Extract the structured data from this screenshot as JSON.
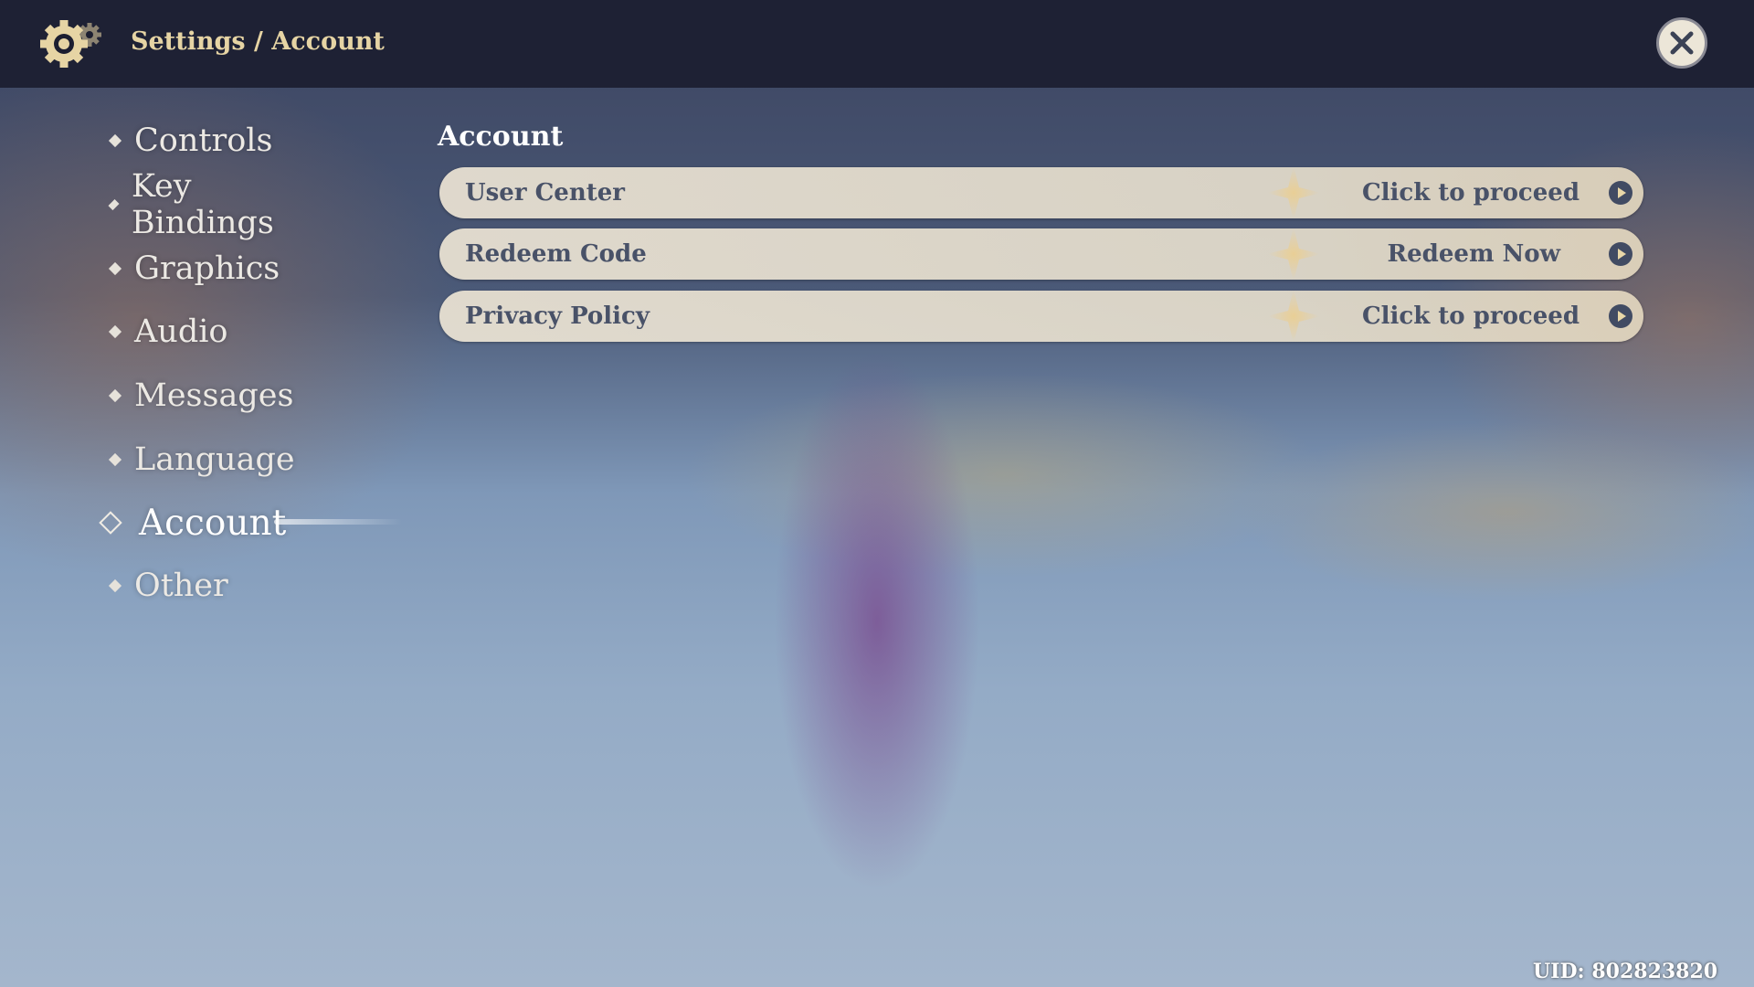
{
  "header": {
    "breadcrumb": "Settings / Account",
    "settings_icon": "gear-icon",
    "close_icon": "close-icon"
  },
  "sidebar": {
    "items": [
      {
        "label": "Controls"
      },
      {
        "label": "Key Bindings"
      },
      {
        "label": "Graphics"
      },
      {
        "label": "Audio"
      },
      {
        "label": "Messages"
      },
      {
        "label": "Language"
      },
      {
        "label": "Account",
        "active": true
      },
      {
        "label": "Other"
      }
    ]
  },
  "main": {
    "title": "Account",
    "rows": [
      {
        "label": "User Center",
        "action": "Click to proceed"
      },
      {
        "label": "Redeem Code",
        "action": "Redeem Now"
      },
      {
        "label": "Privacy Policy",
        "action": "Click to proceed"
      }
    ]
  },
  "footer": {
    "uid": "UID: 802823820"
  },
  "colors": {
    "accent": "#e6d4a4",
    "row_text": "#495268",
    "topbar": "#1c1e30"
  }
}
